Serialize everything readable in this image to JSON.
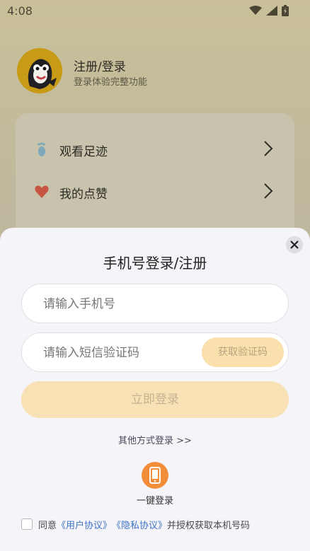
{
  "status_bar": {
    "time": "4:08",
    "icons": [
      "wifi-icon",
      "signal-icon",
      "battery-icon"
    ]
  },
  "profile": {
    "name": "注册/登录",
    "subtitle": "登录体验完整功能"
  },
  "menu": {
    "items": [
      {
        "label": "观看足迹",
        "icon": "footprint-icon"
      },
      {
        "label": "我的点赞",
        "icon": "heart-icon"
      }
    ]
  },
  "login_sheet": {
    "title": "手机号登录/注册",
    "phone_placeholder": "请输入手机号",
    "code_placeholder": "请输入短信验证码",
    "get_code_label": "获取验证码",
    "submit_label": "立即登录",
    "other_methods_label": "其他方式登录 >>",
    "one_key_label": "一键登录",
    "agreement": {
      "prefix": "同意",
      "user_agreement": "《用户协议》",
      "privacy_agreement": "《隐私协议》",
      "suffix": "并授权获取本机号码"
    }
  },
  "colors": {
    "accent_orange": "#f28d3a",
    "button_disabled": "#f8e2b5",
    "link_blue": "#3f74c9"
  }
}
